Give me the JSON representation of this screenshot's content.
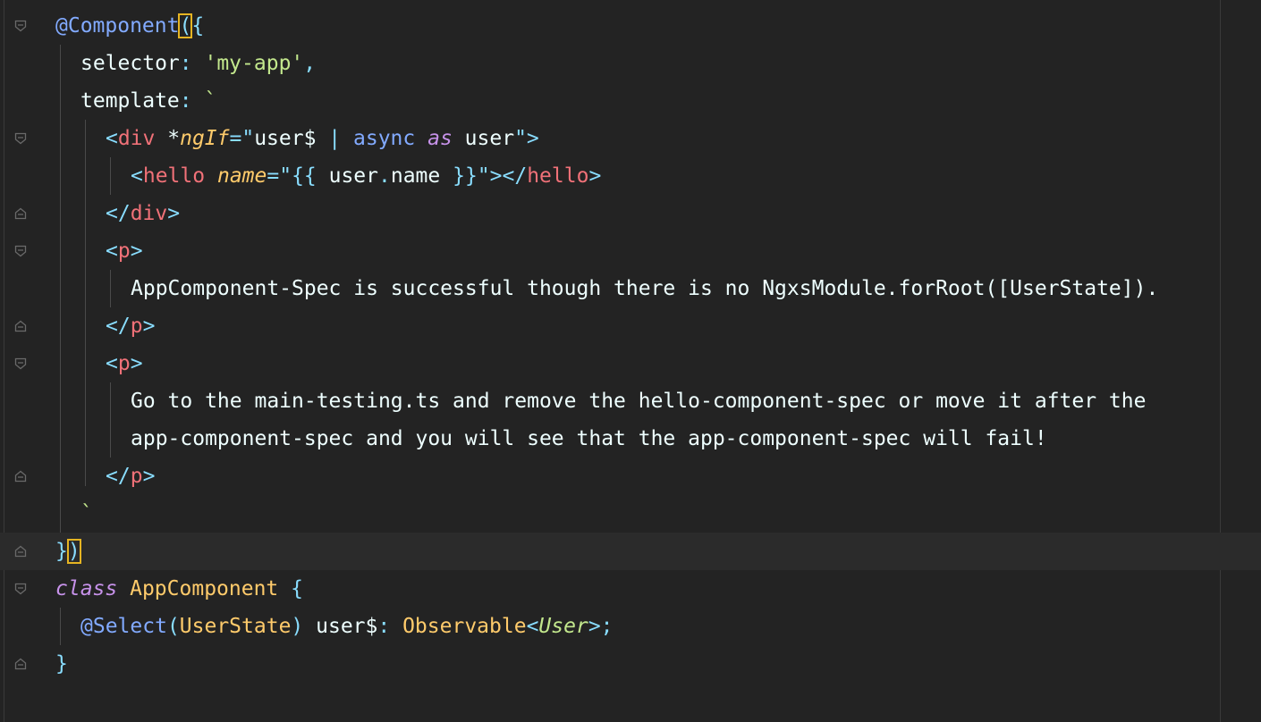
{
  "editor": {
    "lines": [
      {
        "fold": "open",
        "tokens": [
          [
            "deco",
            "@Component"
          ],
          [
            "punc-hl",
            "("
          ],
          [
            "punc",
            "{"
          ]
        ]
      },
      {
        "fold": "",
        "tokens": [
          [
            "plain",
            "selector"
          ],
          [
            "punc",
            ": "
          ],
          [
            "str",
            "'my-app'"
          ],
          [
            "punc",
            ","
          ]
        ]
      },
      {
        "fold": "",
        "tokens": [
          [
            "plain",
            "template"
          ],
          [
            "punc",
            ": "
          ],
          [
            "str",
            "`"
          ]
        ]
      },
      {
        "fold": "open",
        "tokens": [
          [
            "punc",
            "<"
          ],
          [
            "tag",
            "div"
          ],
          [
            "plain",
            " *"
          ],
          [
            "attr",
            "ngIf"
          ],
          [
            "punc",
            "=\""
          ],
          [
            "plain",
            "user$ "
          ],
          [
            "punc",
            "| "
          ],
          [
            "fn",
            "async"
          ],
          [
            "plain",
            " "
          ],
          [
            "kw",
            "as"
          ],
          [
            "plain",
            " user"
          ],
          [
            "punc",
            "\">"
          ]
        ]
      },
      {
        "fold": "",
        "tokens": [
          [
            "punc",
            "<"
          ],
          [
            "tag",
            "hello"
          ],
          [
            "plain",
            " "
          ],
          [
            "attr",
            "name"
          ],
          [
            "punc",
            "=\""
          ],
          [
            "punc",
            "{{ "
          ],
          [
            "plain",
            "user"
          ],
          [
            "punc",
            "."
          ],
          [
            "plain",
            "name "
          ],
          [
            "punc",
            "}}"
          ],
          [
            "punc",
            "\"></"
          ],
          [
            "tag",
            "hello"
          ],
          [
            "punc",
            ">"
          ]
        ]
      },
      {
        "fold": "close",
        "tokens": [
          [
            "punc",
            "</"
          ],
          [
            "tag",
            "div"
          ],
          [
            "punc",
            ">"
          ]
        ]
      },
      {
        "fold": "open",
        "tokens": [
          [
            "punc",
            "<"
          ],
          [
            "tag",
            "p"
          ],
          [
            "punc",
            ">"
          ]
        ]
      },
      {
        "fold": "",
        "tokens": [
          [
            "plain",
            "AppComponent-Spec is successful though there is no NgxsModule.forRoot([UserState]). "
          ]
        ]
      },
      {
        "fold": "close",
        "tokens": [
          [
            "punc",
            "</"
          ],
          [
            "tag",
            "p"
          ],
          [
            "punc",
            ">"
          ]
        ]
      },
      {
        "fold": "open",
        "tokens": [
          [
            "punc",
            "<"
          ],
          [
            "tag",
            "p"
          ],
          [
            "punc",
            ">"
          ]
        ]
      },
      {
        "fold": "",
        "tokens": [
          [
            "plain",
            "Go to the main-testing.ts and remove the hello-component-spec or move it after the"
          ]
        ]
      },
      {
        "fold": "",
        "tokens": [
          [
            "plain",
            "app-component-spec and you will see that the app-component-spec will fail!"
          ]
        ]
      },
      {
        "fold": "close",
        "tokens": [
          [
            "punc",
            "</"
          ],
          [
            "tag",
            "p"
          ],
          [
            "punc",
            ">"
          ]
        ]
      },
      {
        "fold": "",
        "tokens": [
          [
            "str",
            "`"
          ]
        ]
      },
      {
        "fold": "close",
        "tokens": [
          [
            "punc",
            "}"
          ],
          [
            "punc-hl",
            ")"
          ]
        ]
      },
      {
        "fold": "open",
        "tokens": [
          [
            "kw",
            "class"
          ],
          [
            "plain",
            " "
          ],
          [
            "cls",
            "AppComponent"
          ],
          [
            "plain",
            " "
          ],
          [
            "punc",
            "{"
          ]
        ]
      },
      {
        "fold": "",
        "tokens": [
          [
            "deco",
            "@Select"
          ],
          [
            "punc",
            "("
          ],
          [
            "cls",
            "UserState"
          ],
          [
            "punc",
            ")"
          ],
          [
            "plain",
            " user$"
          ],
          [
            "punc",
            ": "
          ],
          [
            "cls",
            "Observable"
          ],
          [
            "punc",
            "<"
          ],
          [
            "type-it",
            "User"
          ],
          [
            "punc",
            ">;"
          ]
        ]
      },
      {
        "fold": "close",
        "tokens": [
          [
            "punc",
            "}"
          ]
        ]
      }
    ]
  }
}
